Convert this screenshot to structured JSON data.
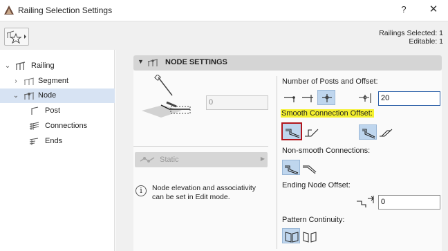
{
  "window": {
    "title": "Railing Selection Settings",
    "help_label": "?",
    "close_label": "✕"
  },
  "selection": {
    "railings_selected": "Railings Selected: 1",
    "editable": "Editable: 1"
  },
  "tree": {
    "items": [
      {
        "label": "Railing",
        "icon": "railing-icon"
      },
      {
        "label": "Segment",
        "icon": "segment-icon"
      },
      {
        "label": "Node",
        "icon": "node-icon"
      },
      {
        "label": "Post",
        "icon": "post-icon"
      },
      {
        "label": "Connections",
        "icon": "connections-icon"
      },
      {
        "label": "Ends",
        "icon": "ends-icon"
      }
    ],
    "selected": "Node"
  },
  "panel": {
    "title": "NODE SETTINGS",
    "node_value": "0",
    "static_label": "Static",
    "info_text": "Node elevation and associativity can be set in Edit mode.",
    "posts_label": "Number of Posts and Offset:",
    "offset_value": "20",
    "smooth_label": "Smooth Connection Offset:",
    "nonsmooth_label": "Non-smooth Connections:",
    "ending_label": "Ending Node Offset:",
    "ending_value": "0",
    "pattern_label": "Pattern Continuity:"
  },
  "colors": {
    "selected_option": "#bfd6ee",
    "highlight": "#f5f12f",
    "focus_frame": "#b1151c",
    "tree_selection": "#d7e3f3"
  }
}
